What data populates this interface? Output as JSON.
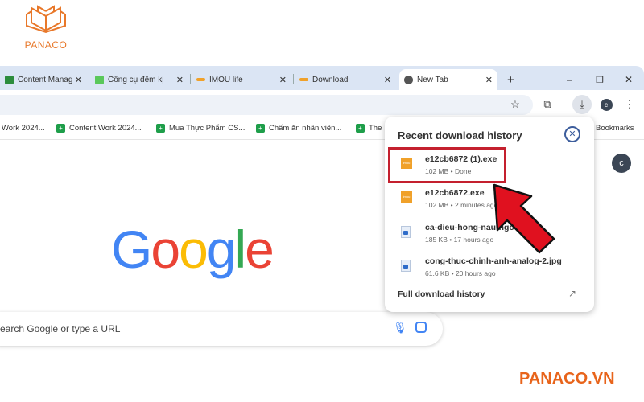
{
  "watermark": {
    "logo_text": "PANACO",
    "site": "PANACO.VN"
  },
  "tabs": [
    {
      "label": "Content Manag",
      "active": false
    },
    {
      "label": "Công cụ đếm kị",
      "active": false
    },
    {
      "label": "IMOU life",
      "active": false
    },
    {
      "label": "Download",
      "active": false
    },
    {
      "label": "New Tab",
      "active": true
    }
  ],
  "tab_close": "✕",
  "new_tab": "+",
  "window": {
    "minimize": "–",
    "restore": "❐",
    "close": "✕"
  },
  "toolbar": {
    "profile_initial": "c"
  },
  "bookmarks": [
    "Work 2024...",
    "Content Work 2024...",
    "Mua Thực Phẩm CS...",
    "Chấm ăn nhân viên...",
    "The",
    "Bookmarks"
  ],
  "page": {
    "logo": "Google",
    "search_placeholder": "earch Google or type a URL",
    "profile_initial": "c"
  },
  "downloads": {
    "title": "Recent download history",
    "items": [
      {
        "name": "e12cb6872 (1).exe",
        "status": "102 MB • Done",
        "type": "exe"
      },
      {
        "name": "e12cb6872.exe",
        "status": "102 MB • 2 minutes ago",
        "type": "exe"
      },
      {
        "name": "ca-dieu-hong-nau-ngot-",
        "status": "185 KB • 17 hours ago",
        "type": "image"
      },
      {
        "name": "cong-thuc-chinh-anh-analog-2.jpg",
        "status": "61.6 KB • 20 hours ago",
        "type": "image"
      }
    ],
    "full_history": "Full download history"
  },
  "colors": {
    "highlight": "#c4202e",
    "arrow": "#e0111f",
    "brand": "#e8641b"
  }
}
